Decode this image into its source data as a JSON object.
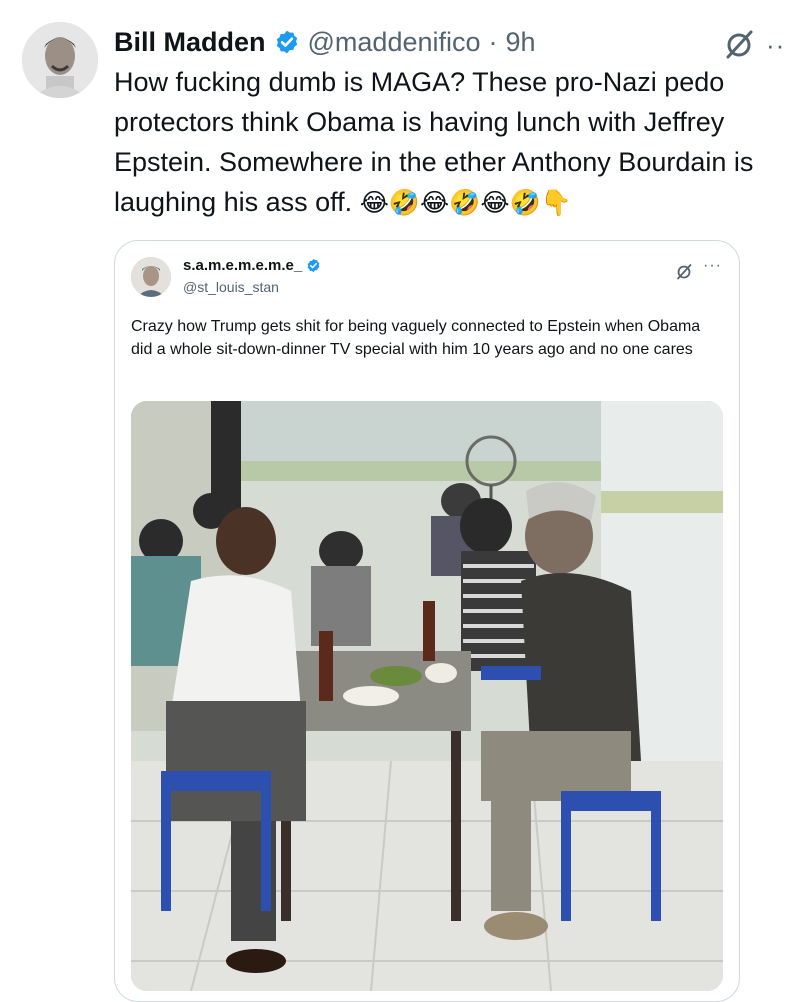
{
  "tweet": {
    "author_name": "Bill Madden",
    "handle": "@maddenifico",
    "separator": "·",
    "time": "9h",
    "text": "How fucking dumb is MAGA? These pro-Nazi pedo protectors think Obama is having lunch with Jeffrey Epstein. Somewhere in the ether Anthony Bourdain is laughing his ass off.",
    "emojis": "😂🤣😂🤣😂🤣👇",
    "more_label": "··",
    "accent_color": "#1d9bf0"
  },
  "quoted": {
    "author_name": "s.a.m.e.m.e.m.e_",
    "handle": "@st_louis_stan",
    "more_label": "···",
    "text": "Crazy how Trump gets shit for being vaguely connected to Epstein when Obama did a whole sit-down-dinner TV special with him 10 years ago and no one cares"
  },
  "photo": {
    "alt": "Photo of two men sitting at a small table in a restaurant"
  },
  "icons": {
    "verified": "verified-badge-icon",
    "grok": "grok-icon",
    "more": "more-icon"
  }
}
